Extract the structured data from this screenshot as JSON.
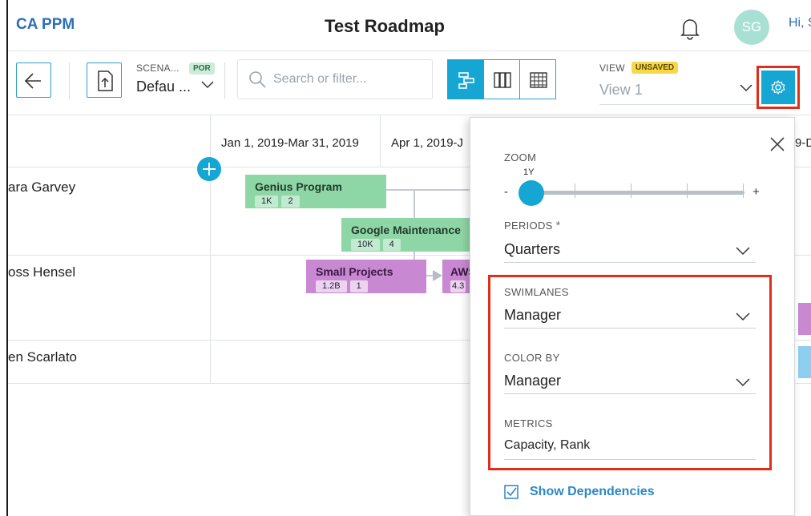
{
  "app": {
    "brand": "CA PPM",
    "title": "Test Roadmap",
    "user_initials": "SG",
    "greeting": "Hi, S"
  },
  "toolbar": {
    "scenario_label": "SCENA...",
    "scenario_badge": "POR",
    "scenario_value": "Defau ...",
    "search_placeholder": "Search or filter...",
    "view_label": "VIEW",
    "view_badge": "UNSAVED",
    "view_value": "View 1"
  },
  "timeline": {
    "periods": [
      "Jan 1, 2019-Mar 31, 2019",
      "Apr 1, 2019-J",
      "9-D"
    ]
  },
  "swimlanes": [
    {
      "name": "ara Garvey"
    },
    {
      "name": "oss Hensel"
    },
    {
      "name": "en Scarlato"
    }
  ],
  "cards": [
    {
      "title": "Genius Program",
      "metrics": [
        "1K",
        "2"
      ],
      "color": "#8fd6a6"
    },
    {
      "title": "Google Maintenance",
      "metrics": [
        "10K",
        "4"
      ],
      "color": "#8fd6a6"
    },
    {
      "title": "Small Projects",
      "metrics": [
        "1.2B",
        "1"
      ],
      "color": "#c889d2"
    },
    {
      "title": "AWS",
      "metrics": [
        "4.3"
      ],
      "color": "#c889d2"
    }
  ],
  "settings": {
    "zoom_label": "ZOOM",
    "zoom_value": "1Y",
    "zoom_min": "-",
    "zoom_max": "+",
    "periods_label": "PERIODS",
    "periods_required": "*",
    "periods_value": "Quarters",
    "swimlanes_label": "SWIMLANES",
    "swimlanes_value": "Manager",
    "color_by_label": "COLOR BY",
    "color_by_value": "Manager",
    "metrics_label": "METRICS",
    "metrics_value": "Capacity, Rank",
    "show_dependencies_label": "Show Dependencies"
  },
  "colors": {
    "accent": "#15a6d4",
    "brand": "#2b6fb5",
    "highlight": "#e02e1a",
    "green_card": "#8fd6a6",
    "purple_card": "#c889d2",
    "blue_stripe": "#8ecff0"
  },
  "icons": [
    "back-arrow-icon",
    "export-icon",
    "chevron-down-icon",
    "search-icon",
    "timeline-view-icon",
    "board-view-icon",
    "grid-view-icon",
    "gear-icon",
    "bell-icon",
    "close-icon",
    "add-icon",
    "checkbox-icon"
  ]
}
